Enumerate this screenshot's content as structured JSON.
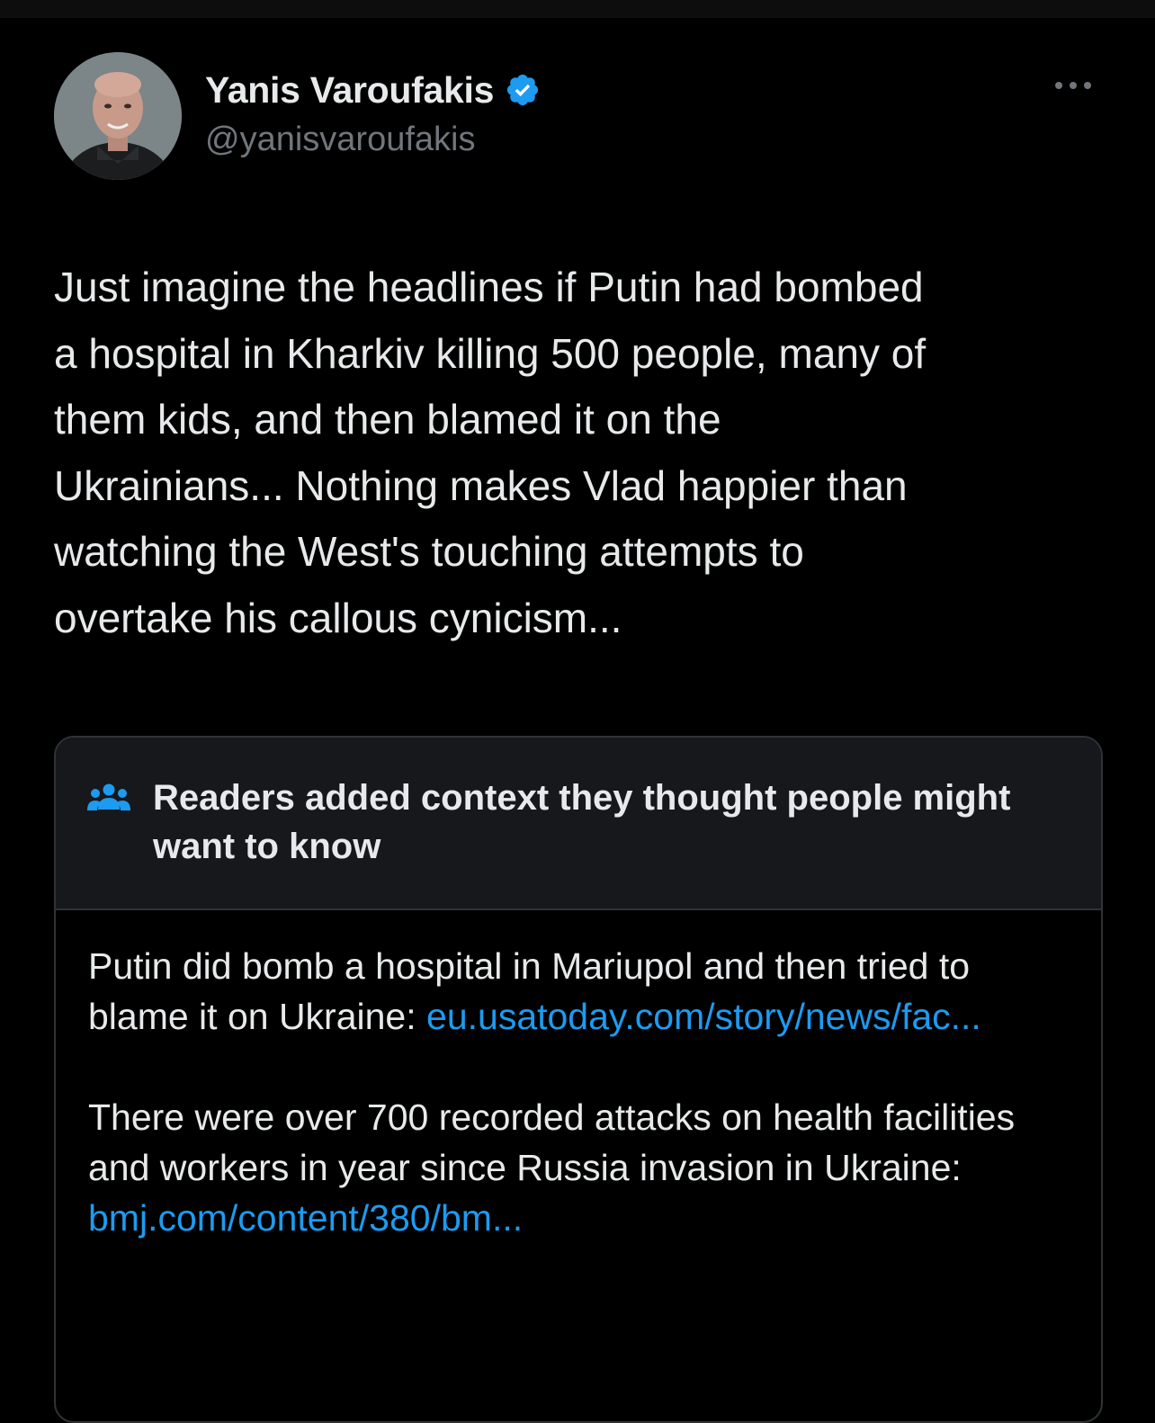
{
  "author": {
    "display_name": "Yanis Varoufakis",
    "handle": "@yanisvaroufakis",
    "verified": true
  },
  "colors": {
    "background": "#000000",
    "text": "#e7e9ea",
    "secondary_text": "#71767b",
    "link": "#1d9bf0",
    "note_header_bg": "#16181c",
    "border": "#2f3336",
    "verified_badge": "#1d9bf0"
  },
  "icons": {
    "verified": "verified-badge-icon",
    "more": "more-horizontal-icon",
    "community_notes": "people-group-icon"
  },
  "tweet": {
    "text": "Just imagine the headlines if Putin had bombed\na hospital in Kharkiv killing 500 people, many of\nthem kids, and then blamed it on the\nUkrainians... Nothing makes Vlad happier than\nwatching the West's touching attempts to\novertake his callous cynicism..."
  },
  "community_note": {
    "title": "Readers added context they thought people might want to know",
    "paragraphs": [
      {
        "text": "Putin did bomb a hospital in Mariupol and then tried to blame it on Ukraine: ",
        "link": "eu.usatoday.com/story/news/fac..."
      },
      {
        "text": "There were over 700 recorded attacks on health facilities and workers in year since Russia invasion in Ukraine: ",
        "link": "bmj.com/content/380/bm..."
      }
    ]
  }
}
